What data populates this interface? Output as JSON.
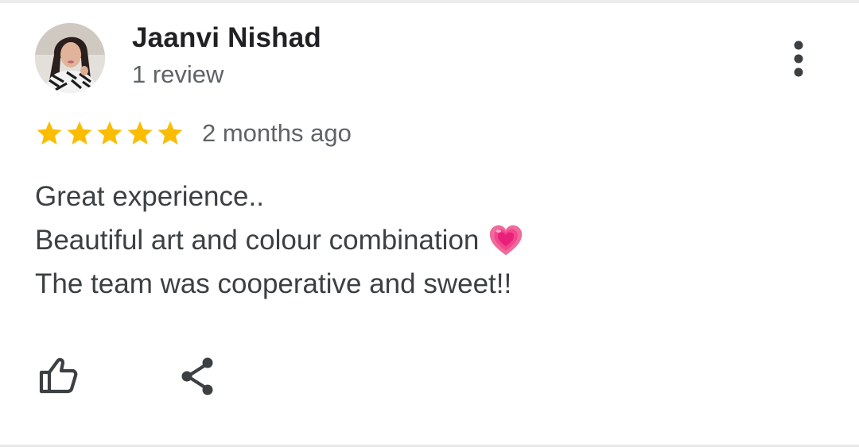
{
  "review": {
    "author_name": "Jaanvi Nishad",
    "review_count": "1 review",
    "rating": 5,
    "max_rating": 5,
    "date": "2 months ago",
    "text_lines": [
      "Great experience..",
      "Beautiful art and colour combination",
      "The team was cooperative and sweet!!"
    ]
  },
  "icons": {
    "more": "more-vert-icon",
    "like": "thumbs-up-icon",
    "share": "share-icon",
    "star": "star-icon",
    "heart": "growing-heart-emoji"
  },
  "colors": {
    "star": "#fbbc04",
    "name": "#202124",
    "secondary": "#5f6368",
    "body_text": "#3c4043",
    "icon": "#3c4043",
    "heart": "#f0508c"
  }
}
